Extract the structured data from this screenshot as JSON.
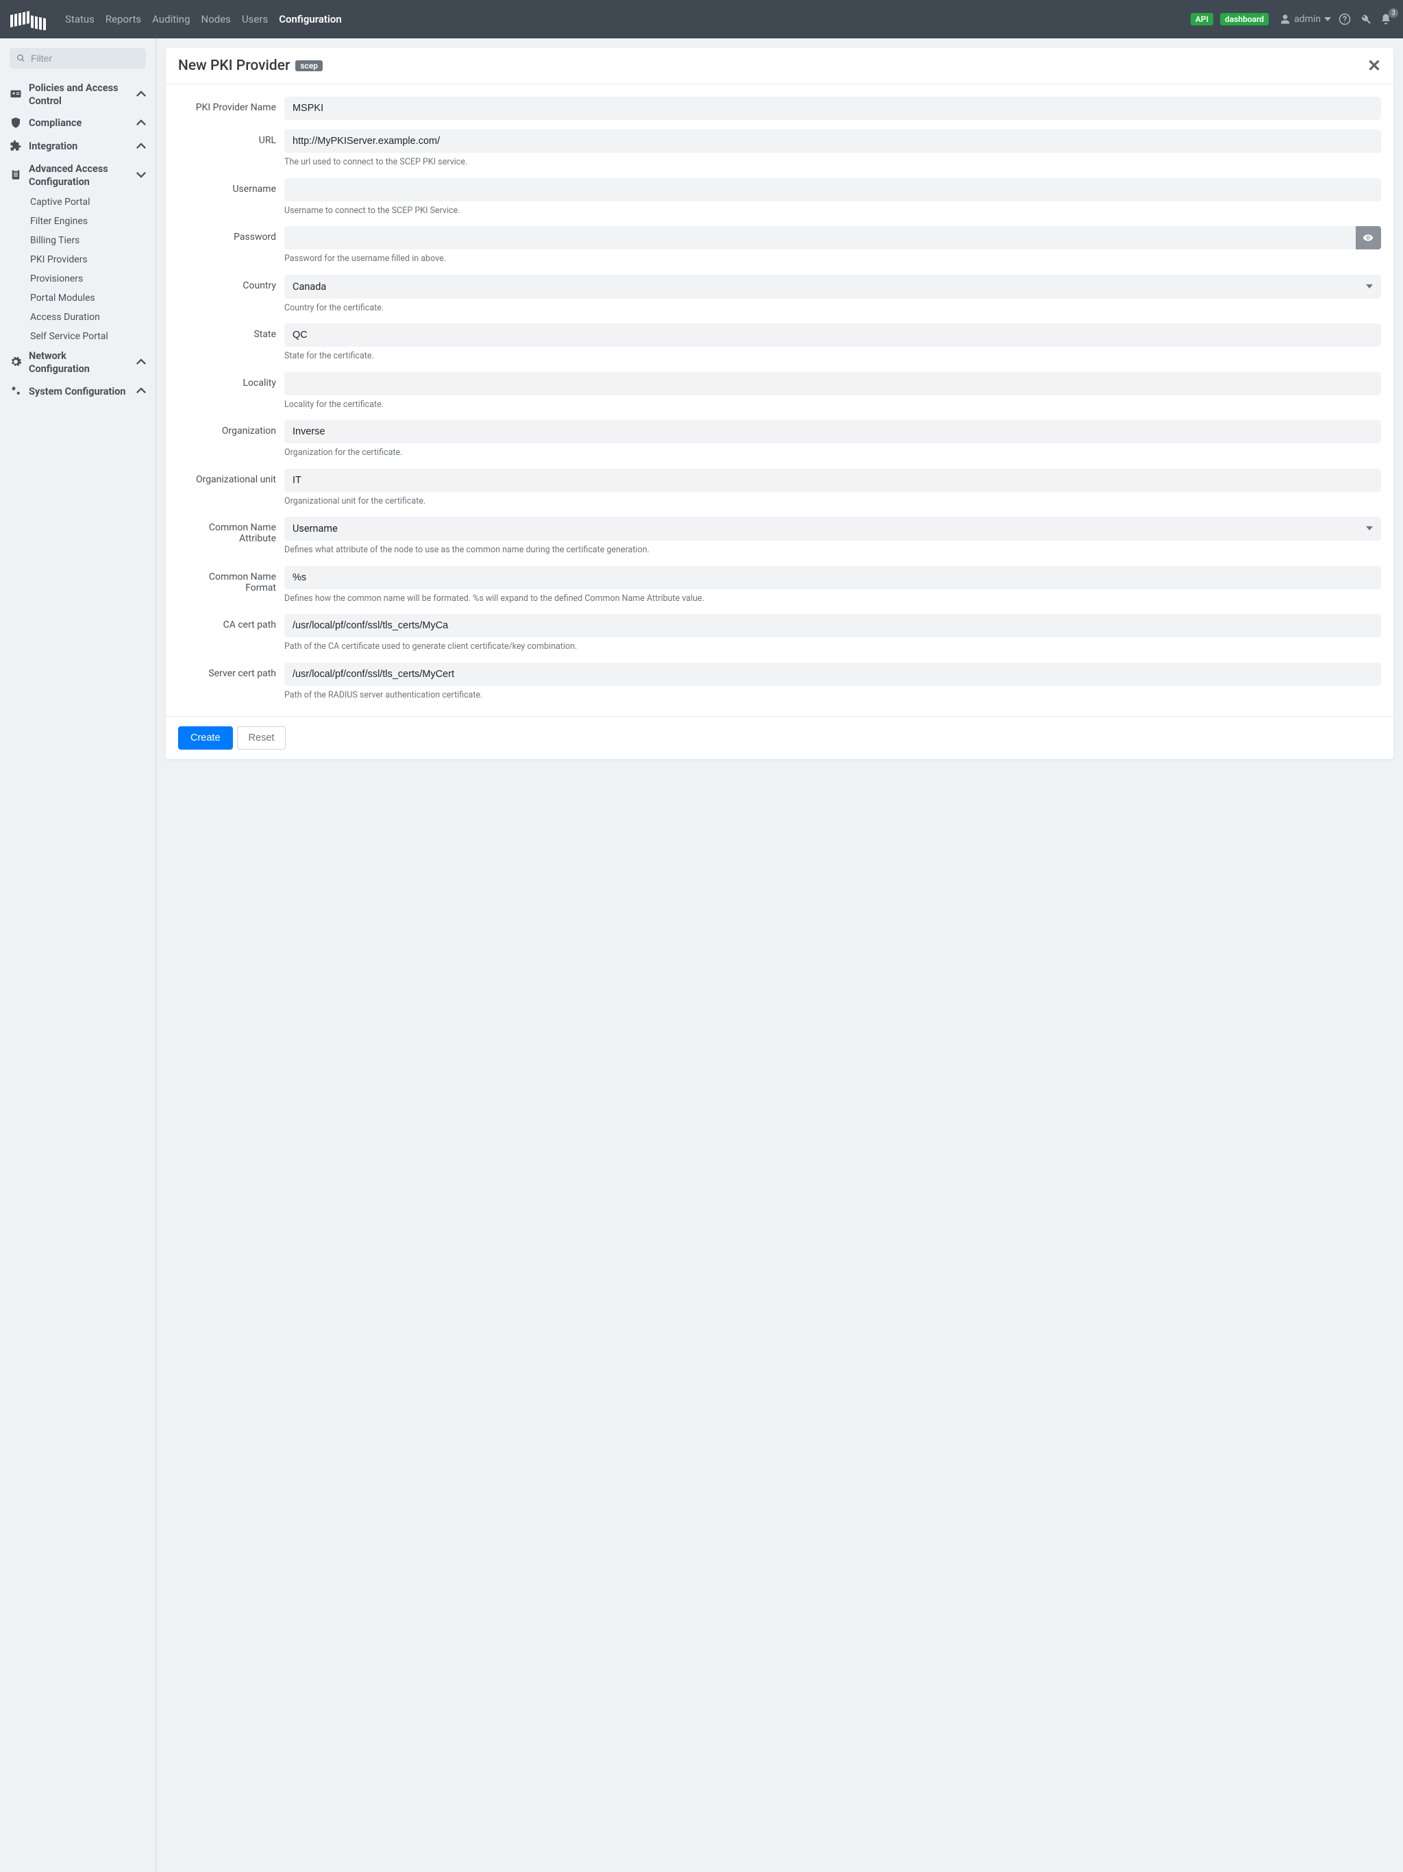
{
  "navbar": {
    "links": [
      "Status",
      "Reports",
      "Auditing",
      "Nodes",
      "Users",
      "Configuration"
    ],
    "active_index": 5,
    "api_badge": "API",
    "dashboard_badge": "dashboard",
    "user": "admin",
    "bell_count": "3"
  },
  "sidebar": {
    "filter_placeholder": "Filter",
    "sections": [
      {
        "label": "Policies and Access Control",
        "expanded": false
      },
      {
        "label": "Compliance",
        "expanded": false
      },
      {
        "label": "Integration",
        "expanded": false
      },
      {
        "label": "Advanced Access Configuration",
        "expanded": true,
        "items": [
          "Captive Portal",
          "Filter Engines",
          "Billing Tiers",
          "PKI Providers",
          "Provisioners",
          "Portal Modules",
          "Access Duration",
          "Self Service Portal"
        ]
      },
      {
        "label": "Network Configuration",
        "expanded": false
      },
      {
        "label": "System Configuration",
        "expanded": false
      }
    ]
  },
  "panel": {
    "title": "New PKI Provider",
    "tag": "scep",
    "fields": {
      "name_label": "PKI Provider Name",
      "name_value": "MSPKI",
      "url_label": "URL",
      "url_value": "http://MyPKIServer.example.com/",
      "url_help": "The url used to connect to the SCEP PKI service.",
      "username_label": "Username",
      "username_value": "",
      "username_help": "Username to connect to the SCEP PKI Service.",
      "password_label": "Password",
      "password_value": "",
      "password_help": "Password for the username filled in above.",
      "country_label": "Country",
      "country_value": "Canada",
      "country_help": "Country for the certificate.",
      "state_label": "State",
      "state_value": "QC",
      "state_help": "State for the certificate.",
      "locality_label": "Locality",
      "locality_value": "",
      "locality_help": "Locality for the certificate.",
      "organization_label": "Organization",
      "organization_value": "Inverse",
      "organization_help": "Organization for the certificate.",
      "org_unit_label": "Organizational unit",
      "org_unit_value": "IT",
      "org_unit_help": "Organizational unit for the certificate.",
      "cn_attr_label": "Common Name Attribute",
      "cn_attr_value": "Username",
      "cn_attr_help": "Defines what attribute of the node to use as the common name during the certificate generation.",
      "cn_fmt_label": "Common Name Format",
      "cn_fmt_value": "%s",
      "cn_fmt_help": "Defines how the common name will be formated. %s will expand to the defined Common Name Attribute value.",
      "ca_cert_label": "CA cert path",
      "ca_cert_value": "/usr/local/pf/conf/ssl/tls_certs/MyCa",
      "ca_cert_help": "Path of the CA certificate used to generate client certificate/key combination.",
      "server_cert_label": "Server cert path",
      "server_cert_value": "/usr/local/pf/conf/ssl/tls_certs/MyCert",
      "server_cert_help": "Path of the RADIUS server authentication certificate."
    },
    "footer": {
      "create": "Create",
      "reset": "Reset"
    }
  }
}
